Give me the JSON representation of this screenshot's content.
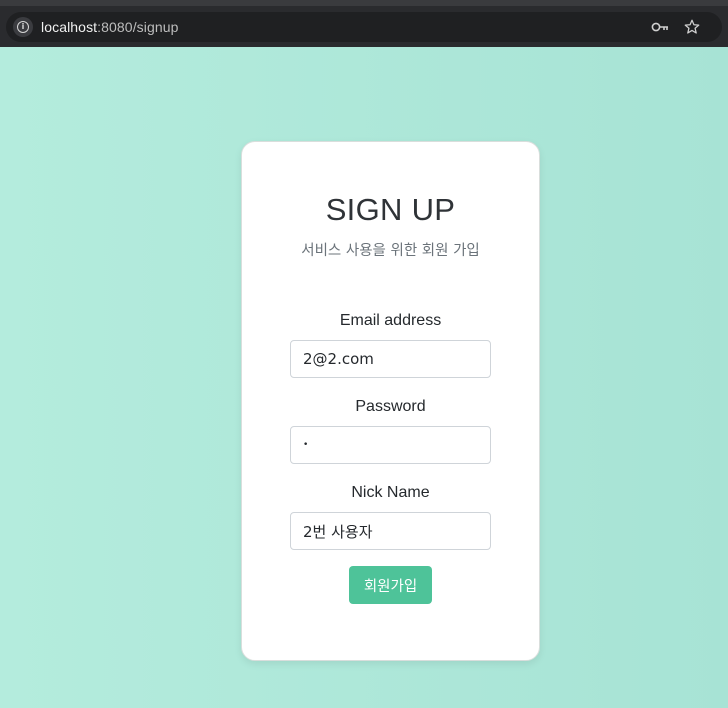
{
  "browser": {
    "url_host": "localhost",
    "url_rest": ":8080/signup"
  },
  "signup": {
    "title": "SIGN UP",
    "subtitle": "서비스 사용을 위한 회원 가입",
    "email": {
      "label": "Email address",
      "value": "2@2.com"
    },
    "password": {
      "label": "Password",
      "value": "•"
    },
    "nickname": {
      "label": "Nick Name",
      "value": "2번 사용자"
    },
    "submit_label": "회원가입"
  },
  "colors": {
    "background_start": "#b4ecdd",
    "background_end": "#a7e3d5",
    "button": "#4ec399"
  }
}
